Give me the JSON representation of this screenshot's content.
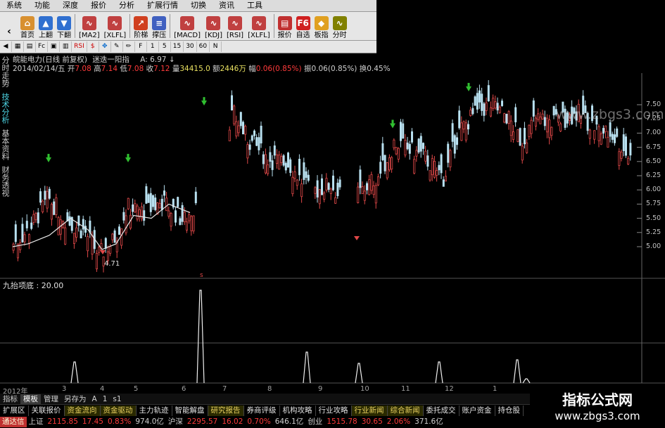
{
  "menu": [
    "系统",
    "功能",
    "深度",
    "报价",
    "分析",
    "扩展行情",
    "切换",
    "资讯",
    "工具"
  ],
  "toolbar": [
    {
      "label": "首页",
      "icon": "home-icon",
      "color": "#d89030",
      "glyph": "⌂"
    },
    {
      "label": "上翻",
      "icon": "arrow-up-icon",
      "color": "#3070d0",
      "glyph": "▲"
    },
    {
      "label": "下翻",
      "icon": "arrow-down-icon",
      "color": "#3070d0",
      "glyph": "▼"
    },
    {
      "label": "[MA2]",
      "icon": "ma2-chart-icon",
      "color": "#c04040",
      "glyph": "∿"
    },
    {
      "label": "[XLFL]",
      "icon": "xlfl-chart-icon",
      "color": "#c04040",
      "glyph": "∿"
    },
    {
      "label": "阶梯",
      "icon": "ladder-icon",
      "color": "#d04020",
      "glyph": "↗"
    },
    {
      "label": "撑压",
      "icon": "support-resist-icon",
      "color": "#4060c0",
      "glyph": "≡"
    },
    {
      "label": "[MACD]",
      "icon": "macd-chart-icon",
      "color": "#c04040",
      "glyph": "∿"
    },
    {
      "label": "[KDJ]",
      "icon": "kdj-chart-icon",
      "color": "#c04040",
      "glyph": "∿"
    },
    {
      "label": "[RSI]",
      "icon": "rsi-chart-icon",
      "color": "#c04040",
      "glyph": "∿"
    },
    {
      "label": "[XLFL]",
      "icon": "xlfl-chart-icon-2",
      "color": "#c04040",
      "glyph": "∿"
    },
    {
      "label": "报价",
      "icon": "quote-icon",
      "color": "#c03030",
      "glyph": "▤"
    },
    {
      "label": "自选",
      "icon": "favorites-icon",
      "color": "#d02020",
      "glyph": "F6"
    },
    {
      "label": "板指",
      "icon": "sector-icon",
      "color": "#e0a020",
      "glyph": "◆"
    },
    {
      "label": "分时",
      "icon": "intraday-icon",
      "color": "#808000",
      "glyph": "∿"
    }
  ],
  "small_toolbar": [
    "◀",
    "▦",
    "▤",
    "Fc",
    "▣",
    "▥",
    "RSI",
    "$",
    "✥",
    "✎",
    "✏",
    "F",
    "1",
    "5",
    "15",
    "30",
    "60",
    "N"
  ],
  "side_tabs": [
    {
      "label": "分时走势",
      "active": false
    },
    {
      "label": "技术分析",
      "active": true
    },
    {
      "label": "基本资料",
      "active": false
    },
    {
      "label": "财务透视",
      "active": false
    }
  ],
  "info": {
    "line1": {
      "name": "皖能电力(日线 前复权)",
      "indicator": "迷迭一阳指",
      "a_label": "A: 6.97"
    },
    "line2": {
      "date": "2014/02/14/五",
      "open_label": "开",
      "open": "7.08",
      "high_label": "高",
      "high": "7.14",
      "low_label": "低",
      "low": "7.08",
      "close_label": "收",
      "close": "7.12",
      "vol_label": "量",
      "vol": "34415.0",
      "amt_label": "额",
      "amt": "2446万",
      "chg_label": "幅",
      "chg": "0.06(0.85%)",
      "amp_label": "振",
      "amp": "0.06(0.85%)",
      "turn_label": "换",
      "turn": "0.45%"
    }
  },
  "price_axis": [
    "7.50",
    "7.25",
    "7.00",
    "6.75",
    "6.50",
    "6.25",
    "6.00",
    "5.75",
    "5.50",
    "5.25",
    "5.00"
  ],
  "low_marker": "4.71",
  "sub_panel": {
    "title": "九抬项底 : 20.00"
  },
  "time_axis": [
    "2012年",
    "3",
    "4",
    "5",
    "6",
    "7",
    "8",
    "9",
    "10",
    "11",
    "12",
    "1"
  ],
  "bg_watermark": "www.zbgs3.com",
  "tabs": [
    {
      "label": "指标",
      "selected": false
    },
    {
      "label": "模板",
      "selected": true
    },
    {
      "label": "管理",
      "selected": false
    },
    {
      "label": "另存为",
      "selected": false
    },
    {
      "label": "A",
      "selected": false
    },
    {
      "label": "1",
      "selected": false
    },
    {
      "label": "s1",
      "selected": false
    }
  ],
  "bottom_nav": [
    {
      "label": "扩展区",
      "hl": false
    },
    {
      "label": "关联报价",
      "hl": false
    },
    {
      "label": "资金流向",
      "hl": true
    },
    {
      "label": "资金驱动",
      "hl": true
    },
    {
      "label": "主力轨迹",
      "hl": false
    },
    {
      "label": "智能解盘",
      "hl": false
    },
    {
      "label": "研究报告",
      "hl": true
    },
    {
      "label": "券商评级",
      "hl": false
    },
    {
      "label": "机构攻略",
      "hl": false
    },
    {
      "label": "行业攻略",
      "hl": false
    },
    {
      "label": "行业新闻",
      "hl": true
    },
    {
      "label": "综合新闻",
      "hl": true
    },
    {
      "label": "委托成交",
      "hl": false
    },
    {
      "label": "账户资金",
      "hl": false
    },
    {
      "label": "持仓股",
      "hl": false
    }
  ],
  "status": {
    "brand": "通达信",
    "sh_label": "上证",
    "sh_val": "2115.85",
    "sh_chg": "17.45",
    "sh_pct": "0.83%",
    "sh_amt": "974.0亿",
    "sz_label": "沪深",
    "sz_val": "2295.57",
    "sz_chg": "16.02",
    "sz_pct": "0.70%",
    "sz_amt": "646.1亿",
    "cy_label": "创业",
    "cy_val": "1515.78",
    "cy_chg": "30.65",
    "cy_pct": "2.06%",
    "cy_amt": "371.6亿"
  },
  "watermark": {
    "title": "指标公式网",
    "url": "www.zbgs3.com"
  },
  "colors": {
    "up": "#ff3b3b",
    "down": "#40e0e0",
    "ma": "#e8e8e8",
    "signal": "#30c030",
    "highlight": "#e8d060"
  }
}
